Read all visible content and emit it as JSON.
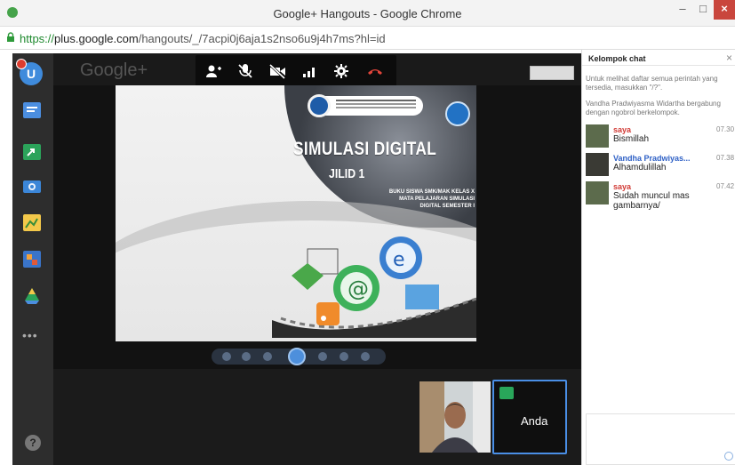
{
  "window": {
    "title": "Google+ Hangouts - Google Chrome",
    "min_label": "–",
    "max_label": "□",
    "close_label": "×"
  },
  "address": {
    "scheme": "https://",
    "host": "plus.google.com",
    "path": "/hangouts/_/7acpi0j6aja1s2nso6u9j4h7ms?hl=id"
  },
  "rail": {
    "avatar_letter": "U",
    "more_label": "•••",
    "help_label": "?"
  },
  "stage": {
    "ghost_logo": "Google+"
  },
  "slide": {
    "title": "SIMULASI DIGITAL",
    "subtitle": "JILID 1",
    "caption": "BUKU SISWA SMK/MAK KELAS X MATA PELAJARAN SIMULASI DIGITAL SEMESTER I"
  },
  "self_tile": {
    "name": "Anda"
  },
  "chat": {
    "title": "Kelompok chat",
    "close_label": "×",
    "system_1": "Untuk melihat daftar semua perintah yang tersedia, masukkan \"/?\".",
    "system_2": "Vandha Pradwiyasma Widartha bergabung dengan ngobrol berkelompok.",
    "messages": [
      {
        "sender": "saya",
        "text": "Bismillah",
        "time": "07.30"
      },
      {
        "sender": "Vandha Pradwiyas...",
        "text": "Alhamdulillah",
        "time": "07.38"
      },
      {
        "sender": "saya",
        "text": "Sudah muncul mas gambarnya/",
        "time": "07.42"
      }
    ]
  },
  "colors": {
    "accent_blue": "#4a8fe6",
    "hangup_red": "#e0443a",
    "self_name": "#d13a35",
    "other_name": "#2f61c6"
  }
}
